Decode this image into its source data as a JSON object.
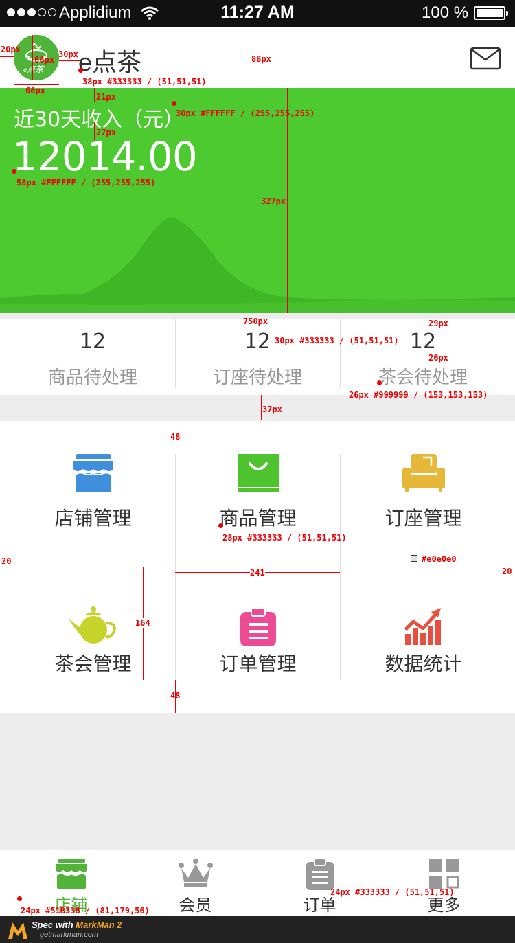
{
  "status_bar": {
    "carrier": "Applidium",
    "time": "11:27 AM",
    "battery": "100 %"
  },
  "header": {
    "title": "e点茶",
    "logo_text": "e点茶"
  },
  "revenue": {
    "label": "近30天收入（元）",
    "amount": "12014.00"
  },
  "stats": [
    {
      "value": "12",
      "label": "商品待处理"
    },
    {
      "value": "12",
      "label": "订座待处理"
    },
    {
      "value": "12",
      "label": "茶会待处理"
    }
  ],
  "menu": [
    {
      "label": "店铺管理",
      "icon": "shop-icon",
      "color": "#3f8fdc"
    },
    {
      "label": "商品管理",
      "icon": "shopping-bag-icon",
      "color": "#4dc42e"
    },
    {
      "label": "订座管理",
      "icon": "sofa-icon",
      "color": "#e7b739"
    },
    {
      "label": "茶会管理",
      "icon": "teapot-icon",
      "color": "#c5d32b"
    },
    {
      "label": "订单管理",
      "icon": "clipboard-icon",
      "color": "#ee4b95"
    },
    {
      "label": "数据统计",
      "icon": "chart-icon",
      "color": "#e94f3e"
    }
  ],
  "tabbar": [
    {
      "label": "店铺",
      "icon": "shop-icon",
      "active": true
    },
    {
      "label": "会员",
      "icon": "crown-icon",
      "active": false
    },
    {
      "label": "订单",
      "icon": "clipboard-icon",
      "active": false
    },
    {
      "label": "更多",
      "icon": "grid-icon",
      "active": false
    }
  ],
  "colors": {
    "brand_green": "#4dca2f",
    "text_dark": "#333333",
    "text_gray": "#999999",
    "tab_active": "#51b338",
    "divider": "#e0e0e0"
  },
  "footer": {
    "brand_prefix": "Spec with ",
    "brand_name": "MarkMan 2",
    "url": "getmarkman.com"
  },
  "annotations": {
    "a1": "20px",
    "a2": "66px",
    "a3": "30px",
    "a4": "66px",
    "a5": "88px",
    "a6": "38px #333333 / (51,51,51)",
    "a7": "21px",
    "a8": "30px #FFFFFF / (255,255,255)",
    "a9": "27px",
    "a10": "58px #FFFFFF / (255,255,255)",
    "a11": "327px",
    "a12": "750px",
    "a13": "29px",
    "a14": "30px #333333 / (51,51,51)",
    "a15": "26px",
    "a16": "26px #999999 / (153,153,153)",
    "a17": "37px",
    "a18": "48",
    "a19": "28px #333333 / (51,51,51)",
    "a20": "#e0e0e0",
    "a21": "20",
    "a22": "241",
    "a23": "20",
    "a24": "164",
    "a25": "48",
    "a26": "24px #333333 / (51,51,51)",
    "a27": "24px #51B338 / (81,179,56)"
  }
}
